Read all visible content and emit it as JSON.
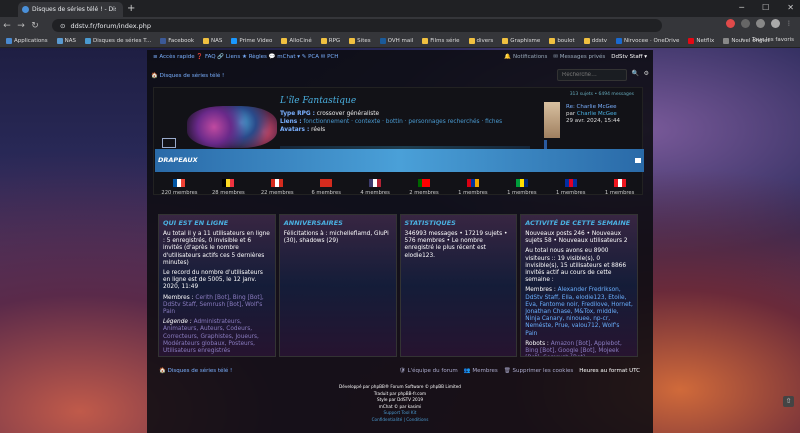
{
  "browser": {
    "tab_title": "Disques de séries télé ! - Disq...",
    "url": "ddstv.fr/forum/index.php",
    "bookmarks": [
      "Applications",
      "NAS",
      "Disques de séries T...",
      "Facebook",
      "NAS",
      "Prime Video",
      "AlloCiné",
      "RPG",
      "Sites",
      "OVH mail",
      "Films série",
      "divers",
      "Graphisme",
      "boulot",
      "ddstv",
      "Nirvocee · OneDrive",
      "Netflix",
      "Nouvel onglet"
    ],
    "bookmarks_right": "Tous les favoris"
  },
  "topnav": {
    "left": "≡ Accès rapide   ❓ FAQ   🔗 Liens   ★ Règles   💬 mChat ▾   ✎ PCA   ✉ PCH",
    "notifications": "🔔 Notifications",
    "messages": "✉ Messages privés",
    "user": "DdStv Staff ▾"
  },
  "sitebar": {
    "crumb": "🏠 Disques de séries télé !",
    "search_placeholder": "Recherche…"
  },
  "rpg": {
    "title": "L'île Fantastique",
    "type_label": "Type RPG :",
    "type_value": "crossover généraliste",
    "liens_label": "Liens :",
    "liens_value": "fonctionnement · contexte · bottin · personnages recherchés · fiches",
    "avatars_label": "Avatars :",
    "avatars_value": "réels"
  },
  "lastpost": {
    "header": "313 sujets • 6494 messages",
    "title": "Re: Charlie McGee",
    "by": "par",
    "author": "Charlie McGee",
    "date": "29 avr. 2024, 15:44"
  },
  "drapeaux": {
    "title": "DRAPEAUX",
    "flags": [
      {
        "colors": [
          "#0055a4",
          "#ffffff",
          "#ef4135"
        ],
        "count": "220 membres"
      },
      {
        "colors": [
          "#000000",
          "#fdda24",
          "#ef3340"
        ],
        "count": "28 membres"
      },
      {
        "colors": [
          "#d52b1e",
          "#ffffff",
          "#d52b1e"
        ],
        "count": "22 membres"
      },
      {
        "colors": [
          "#d52b1e",
          "#d52b1e",
          "#d52b1e"
        ],
        "count": "6 membres"
      },
      {
        "colors": [
          "#3c3b6e",
          "#ffffff",
          "#b22234"
        ],
        "count": "4 membres"
      },
      {
        "colors": [
          "#006600",
          "#ff0000",
          "#ff0000"
        ],
        "count": "2 membres"
      },
      {
        "colors": [
          "#d90012",
          "#0033a0",
          "#f2a800"
        ],
        "count": "1 membres"
      },
      {
        "colors": [
          "#009c3b",
          "#ffdf00",
          "#002776"
        ],
        "count": "1 membres"
      },
      {
        "colors": [
          "#032ea1",
          "#e00025",
          "#032ea1"
        ],
        "count": "1 membres"
      },
      {
        "colors": [
          "#ee161f",
          "#ffffff",
          "#ee161f"
        ],
        "count": "1 membres"
      }
    ]
  },
  "panels": {
    "online": {
      "title": "QUI EST EN LIGNE",
      "p1": "Au total il y a 11 utilisateurs en ligne : 5 enregistrés, 0 invisible et 6 invités (d'après le nombre d'utilisateurs actifs ces 5 dernières minutes)",
      "p2": "Le record du nombre d'utilisateurs en ligne est de 5005, le 12 janv. 2020, 11:49",
      "members_label": "Membres :",
      "members": "Cerith [Bot], Bing [Bot], DdStv Staff, Semrush [Bot], Wolf's Pain",
      "legend_label": "Légende :",
      "legend": "Administrateurs, Animateurs, Auteurs, Codeurs, Correcteurs, Graphistes, Joueurs, Modérateurs globaux, Posteurs, Utilisateurs enregistrés"
    },
    "anniv": {
      "title": "ANNIVERSAIRES",
      "text": "Félicitations à : michelleflamd, GluPi (30), shadows (29)"
    },
    "stats": {
      "title": "STATISTIQUES",
      "text": "346993 messages • 17219 sujets • 576 membres • Le nombre enregistré le plus récent est elodie123."
    },
    "activity": {
      "title": "ACTIVITÉ DE CETTE SEMAINE",
      "p1": "Nouveaux posts 246 • Nouveaux sujets 58 • Nouveaux utilisateurs 2",
      "p2": "Au total nous avons eu 8900 visiteurs :: 19 visible(s), 0 invisible(s), 15 utilisateurs et 8866 invités actif au cours de cette semaine :",
      "members_label": "Membres :",
      "members": "Alexander Fredrikson, DdStv Staff, Ella, elodie123, Etoile, Eva, Fantome noir, Fredilove, Hornet, Jonathan Chase, M&Tox, middle, Ninja Canary, ninouee, np-cr, Neméste, Prue, valou712, Wolf's Pain",
      "robots_label": "Robots :",
      "robots": "Amazon [Bot], Applebot, Bing [Bot], Google [Bot], Mojeek [Bot], Semrush [Bot]"
    }
  },
  "bottombar": {
    "crumb": "🏠 Disques de séries télé !",
    "team": "🛡 L'équipe du forum",
    "members": "👥 Membres",
    "cookies": "🗑 Supprimer les cookies",
    "tz": "Heures au format UTC"
  },
  "footer": {
    "l1": "Développé par phpBB® Forum Software © phpBB Limited",
    "l2": "Traduit par phpBB-fr.com",
    "l3": "Style par DdSTV 2019",
    "l4": "mChat © par kasimi",
    "l5": "Support Tool Kit",
    "l6": "Confidentialité | Conditions"
  }
}
